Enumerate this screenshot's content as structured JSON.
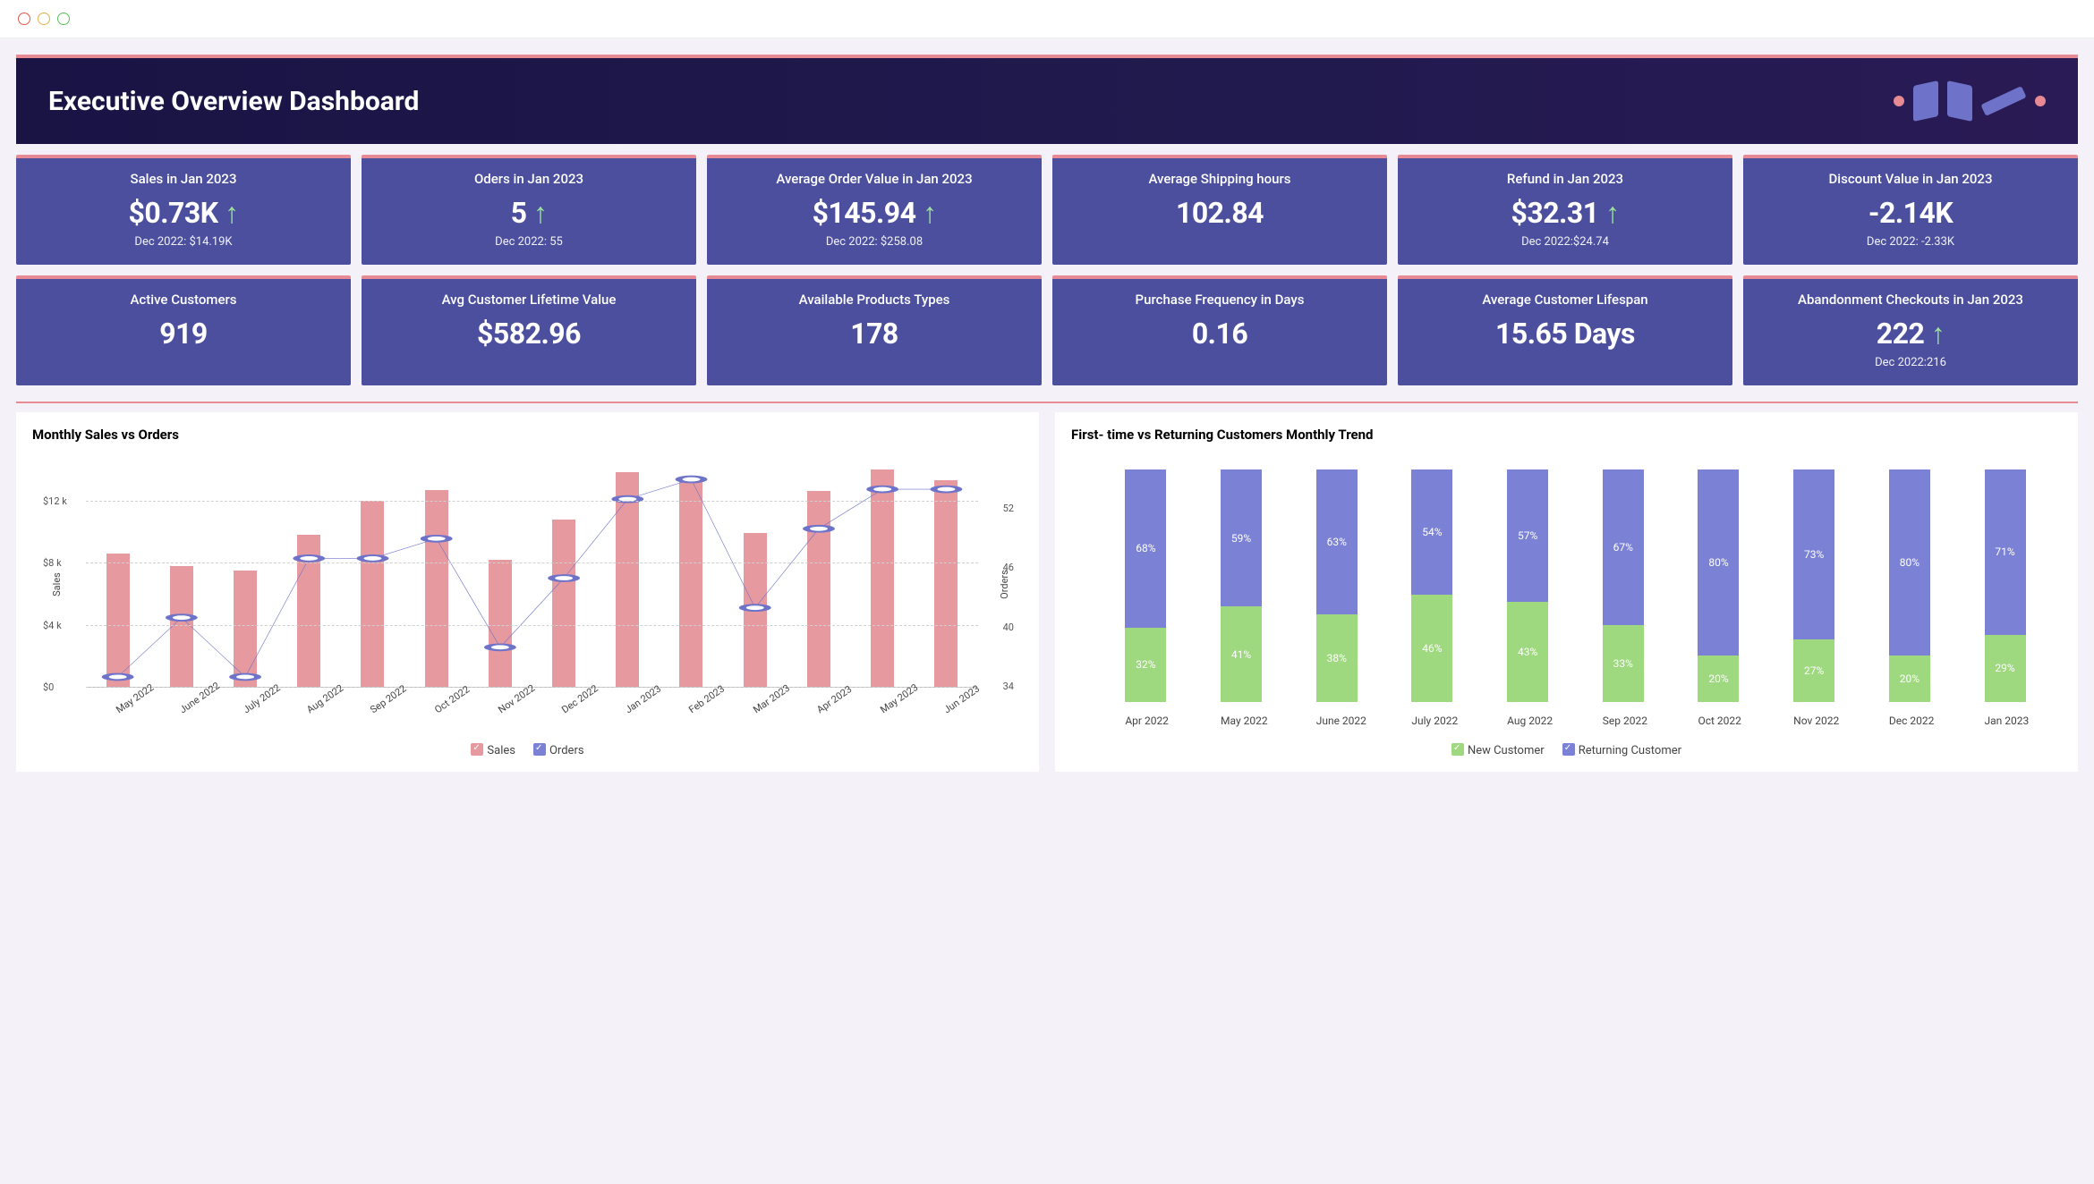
{
  "page_title": "Executive Overview Dashboard",
  "kpi_row1": [
    {
      "label": "Sales in Jan 2023",
      "value": "$0.73K",
      "arrow": true,
      "sub": "Dec 2022: $14.19K"
    },
    {
      "label": "Oders in Jan 2023",
      "value": "5",
      "arrow": true,
      "sub": "Dec 2022: 55"
    },
    {
      "label": "Average Order Value in Jan 2023",
      "value": "$145.94",
      "arrow": true,
      "sub": "Dec 2022: $258.08"
    },
    {
      "label": "Average Shipping hours",
      "value": "102.84",
      "arrow": false,
      "sub": ""
    },
    {
      "label": "Refund in Jan 2023",
      "value": "$32.31",
      "arrow": true,
      "sub": "Dec 2022:$24.74"
    },
    {
      "label": "Discount Value in Jan 2023",
      "value": "-2.14K",
      "arrow": false,
      "sub": "Dec 2022:  -2.33K"
    }
  ],
  "kpi_row2": [
    {
      "label": "Active Customers",
      "value": "919",
      "arrow": false,
      "sub": ""
    },
    {
      "label": "Avg Customer Lifetime Value",
      "value": "$582.96",
      "arrow": false,
      "sub": ""
    },
    {
      "label": "Available Products Types",
      "value": "178",
      "arrow": false,
      "sub": ""
    },
    {
      "label": "Purchase Frequency in Days",
      "value": "0.16",
      "arrow": false,
      "sub": ""
    },
    {
      "label": "Average Customer Lifespan",
      "value": "15.65 Days",
      "arrow": false,
      "sub": ""
    },
    {
      "label": "Abandonment Checkouts in Jan 2023",
      "value": "222",
      "arrow": true,
      "sub": "Dec 2022:216"
    }
  ],
  "chart1_title": "Monthly Sales vs Orders",
  "chart2_title": "First- time vs Returning  Customers Monthly Trend",
  "legend": {
    "sales": "Sales",
    "orders": "Orders",
    "new": "New Customer",
    "returning": "Returning Customer"
  },
  "axis": {
    "sales": "Sales",
    "orders": "Orders"
  },
  "chart_data": [
    {
      "type": "bar+line",
      "title": "Monthly Sales vs Orders",
      "categories": [
        "May 2022",
        "June 2022",
        "July 2022",
        "Aug 2022",
        "Sep 2022",
        "Oct 2022",
        "Nov 2022",
        "Dec 2022",
        "Jan 2023",
        "Feb 2023",
        "Mar 2023",
        "Apr 2023",
        "May 2023",
        "Jun 2023"
      ],
      "series": [
        {
          "name": "Sales",
          "type": "bar",
          "axis": "left",
          "values": [
            8600,
            7800,
            7500,
            9800,
            12000,
            12700,
            8200,
            10800,
            13800,
            13300,
            9900,
            12600,
            14000,
            13300
          ]
        },
        {
          "name": "Orders",
          "type": "line",
          "axis": "right",
          "values": [
            35,
            41,
            35,
            47,
            47,
            49,
            38,
            45,
            53,
            55,
            42,
            50,
            54,
            54
          ]
        }
      ],
      "ylabel_left": "Sales",
      "ylabel_right": "Orders",
      "ylim_left": [
        0,
        14000
      ],
      "yticks_left": [
        0,
        4000,
        8000,
        12000
      ],
      "ytick_labels_left": [
        "$0",
        "$4 k",
        "$8 k",
        "$12 k"
      ],
      "ylim_right": [
        34,
        56
      ],
      "yticks_right": [
        34,
        40,
        46,
        52
      ]
    },
    {
      "type": "stacked-bar-100",
      "title": "First- time vs Returning  Customers Monthly Trend",
      "categories": [
        "Apr 2022",
        "May 2022",
        "June 2022",
        "July 2022",
        "Aug 2022",
        "Sep 2022",
        "Oct 2022",
        "Nov 2022",
        "Dec 2022",
        "Jan 2023"
      ],
      "series": [
        {
          "name": "New Customer",
          "values": [
            32,
            41,
            38,
            46,
            43,
            33,
            20,
            27,
            20,
            29
          ]
        },
        {
          "name": "Returning Customer",
          "values": [
            68,
            59,
            63,
            54,
            57,
            67,
            80,
            73,
            80,
            71
          ]
        }
      ],
      "unit": "%",
      "ylim": [
        0,
        100
      ]
    }
  ]
}
